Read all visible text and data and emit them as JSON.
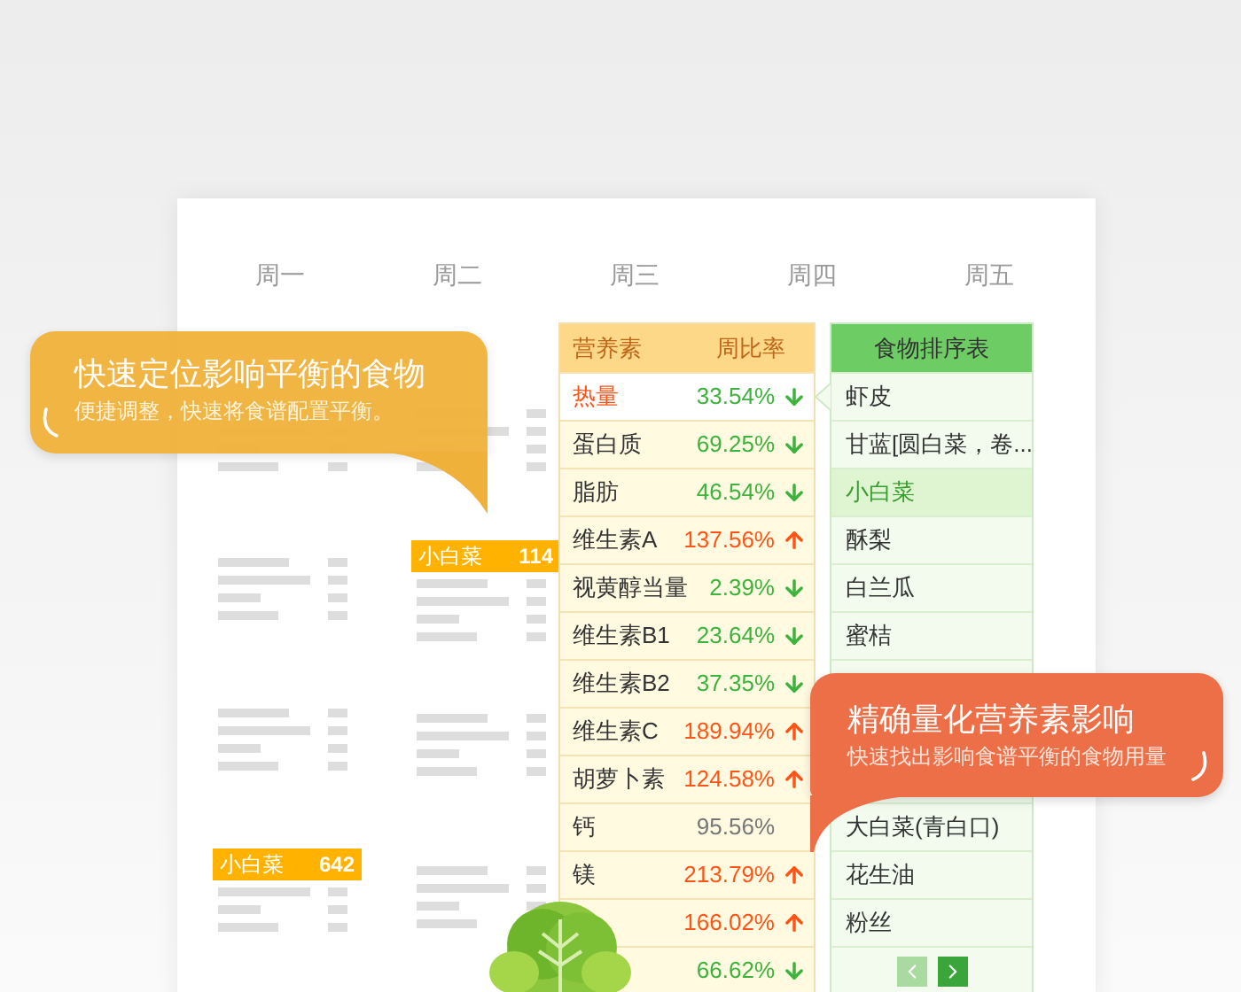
{
  "days": [
    {
      "label": "周一"
    },
    {
      "label": "周二"
    },
    {
      "label": "周三"
    },
    {
      "label": "周四"
    },
    {
      "label": "周五"
    }
  ],
  "menu_tags": [
    {
      "name": "小白菜",
      "amount": "114"
    },
    {
      "name": "小白菜",
      "amount": "642"
    }
  ],
  "nutrient_table": {
    "columns": [
      "营养素",
      "周比率"
    ],
    "rows": [
      {
        "name": "热量",
        "ratio": "33.54%",
        "kind": "down",
        "selected": true
      },
      {
        "name": "蛋白质",
        "ratio": "69.25%",
        "kind": "down",
        "selected": false
      },
      {
        "name": "脂肪",
        "ratio": "46.54%",
        "kind": "down",
        "selected": false
      },
      {
        "name": "维生素A",
        "ratio": "137.56%",
        "kind": "up",
        "selected": false
      },
      {
        "name": "视黄醇当量",
        "ratio": "2.39%",
        "kind": "down",
        "selected": false
      },
      {
        "name": "维生素B1",
        "ratio": "23.64%",
        "kind": "down",
        "selected": false
      },
      {
        "name": "维生素B2",
        "ratio": "37.35%",
        "kind": "down",
        "selected": false
      },
      {
        "name": "维生素C",
        "ratio": "189.94%",
        "kind": "up",
        "selected": false
      },
      {
        "name": "胡萝卜素",
        "ratio": "124.58%",
        "kind": "up",
        "selected": false
      },
      {
        "name": "钙",
        "ratio": "95.56%",
        "kind": "flat",
        "selected": false
      },
      {
        "name": "镁",
        "ratio": "213.79%",
        "kind": "up",
        "selected": false
      },
      {
        "ratio": "166.02%",
        "kind": "up",
        "selected": false
      },
      {
        "ratio": "66.62%",
        "kind": "down",
        "selected": false
      }
    ]
  },
  "food_table": {
    "title": "食物排序表",
    "rows": [
      {
        "name": "虾皮",
        "selected": false
      },
      {
        "name": "甘蓝[圆白菜，卷...",
        "selected": false
      },
      {
        "name": "小白菜",
        "selected": true
      },
      {
        "name": "酥梨",
        "selected": false
      },
      {
        "name": "白兰瓜",
        "selected": false
      },
      {
        "name": "蜜桔",
        "selected": false
      }
    ],
    "rows_below_callout": [
      {
        "name": "大白菜(青白口)",
        "selected": false
      },
      {
        "name": "花生油",
        "selected": false
      },
      {
        "name": "粉丝",
        "selected": false
      }
    ],
    "pagination": {
      "prev": {
        "disabled": true
      },
      "next": {
        "disabled": false
      }
    }
  },
  "callouts": [
    {
      "title": "快速定位影响平衡的食物",
      "subtitle": "便捷调整，快速将食谱配置平衡。"
    },
    {
      "title": "精确量化营养素影响",
      "subtitle": "快速找出影响食谱平衡的食物用量"
    }
  ]
}
